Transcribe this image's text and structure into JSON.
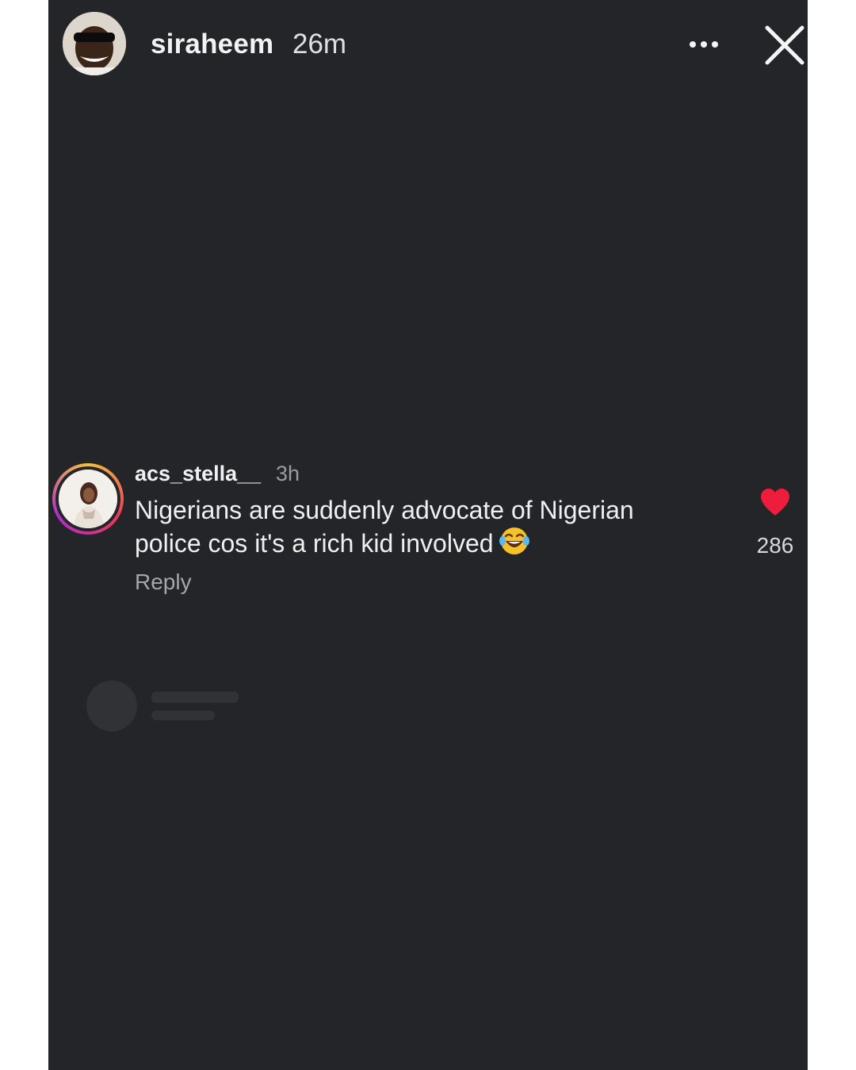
{
  "story": {
    "username": "siraheem",
    "time": "26m",
    "avatar_icon": "user-avatar-photo",
    "more_icon": "more-horizontal-icon",
    "close_icon": "close-icon"
  },
  "comment": {
    "username": "acs_stella__",
    "time": "3h",
    "text": "Nigerians are suddenly advocate of Nigerian police cos it's a rich kid involved",
    "emoji": "face-with-tears-of-joy",
    "reply_label": "Reply",
    "like_count": "286",
    "like_icon": "heart-icon",
    "like_color": "#ee1d3c",
    "ring_colors": [
      "#f5c33b",
      "#e8395a",
      "#b02bd0"
    ]
  },
  "colors": {
    "background": "#232529",
    "text_primary": "#f2f2f2",
    "text_secondary": "#9a9ca0"
  }
}
